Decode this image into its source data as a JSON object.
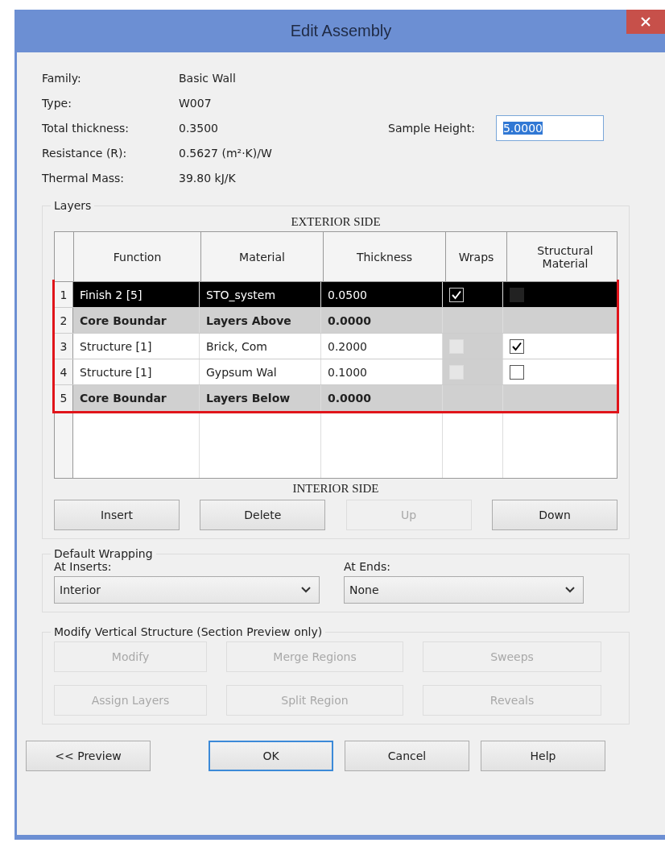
{
  "window": {
    "title": "Edit Assembly"
  },
  "info": [
    {
      "label": "Family:",
      "value": "Basic Wall"
    },
    {
      "label": "Type:",
      "value": "W007"
    },
    {
      "label": "Total thickness:",
      "value": "0.3500"
    },
    {
      "label": "Resistance (R):",
      "value": "0.5627 (m²·K)/W"
    },
    {
      "label": "Thermal Mass:",
      "value": "39.80 kJ/K"
    }
  ],
  "sample_height": {
    "label": "Sample Height:",
    "value": "5.0000"
  },
  "layers": {
    "title": "Layers",
    "exterior_label": "EXTERIOR SIDE",
    "interior_label": "INTERIOR SIDE",
    "columns": [
      "Function",
      "Material",
      "Thickness",
      "Wraps",
      "Structural Material"
    ],
    "rows": [
      {
        "number": "1",
        "function": "Finish 2 [5]",
        "material": "STO_system",
        "thickness": "0.0500",
        "kind": "layer",
        "selected": true,
        "wraps": {
          "checked": true,
          "disabled": false
        },
        "structural": {
          "checked": false,
          "disabled": true
        }
      },
      {
        "number": "2",
        "function": "Core Boundar",
        "material": "Layers Above",
        "thickness": "0.0000",
        "kind": "boundary",
        "selected": false
      },
      {
        "number": "3",
        "function": "Structure [1]",
        "material": "Brick, Com",
        "thickness": "0.2000",
        "kind": "layer",
        "selected": false,
        "wraps": {
          "checked": false,
          "disabled": true
        },
        "structural": {
          "checked": true,
          "disabled": false
        }
      },
      {
        "number": "4",
        "function": "Structure [1]",
        "material": "Gypsum Wal",
        "thickness": "0.1000",
        "kind": "layer",
        "selected": false,
        "wraps": {
          "checked": false,
          "disabled": true
        },
        "structural": {
          "checked": false,
          "disabled": false
        }
      },
      {
        "number": "5",
        "function": "Core Boundar",
        "material": "Layers Below",
        "thickness": "0.0000",
        "kind": "boundary",
        "selected": false
      }
    ],
    "buttons": [
      {
        "label": "Insert",
        "disabled": false
      },
      {
        "label": "Delete",
        "disabled": false
      },
      {
        "label": "Up",
        "disabled": true
      },
      {
        "label": "Down",
        "disabled": false
      }
    ]
  },
  "default_wrapping": {
    "title": "Default Wrapping",
    "fields": [
      {
        "label": "At Inserts:",
        "value": "Interior"
      },
      {
        "label": "At Ends:",
        "value": "None"
      }
    ]
  },
  "vertical_structure": {
    "title": "Modify Vertical Structure (Section Preview only)",
    "buttons": [
      {
        "label": "Modify",
        "disabled": true
      },
      {
        "label": "Merge Regions",
        "disabled": true
      },
      {
        "label": "Sweeps",
        "disabled": true
      },
      {
        "label": "Assign Layers",
        "disabled": true
      },
      {
        "label": "Split Region",
        "disabled": true
      },
      {
        "label": "Reveals",
        "disabled": true
      }
    ]
  },
  "footer_buttons": [
    {
      "label": "<< Preview",
      "default": false
    },
    {
      "label": "OK",
      "default": true
    },
    {
      "label": "Cancel",
      "default": false
    },
    {
      "label": "Help",
      "default": false
    }
  ]
}
